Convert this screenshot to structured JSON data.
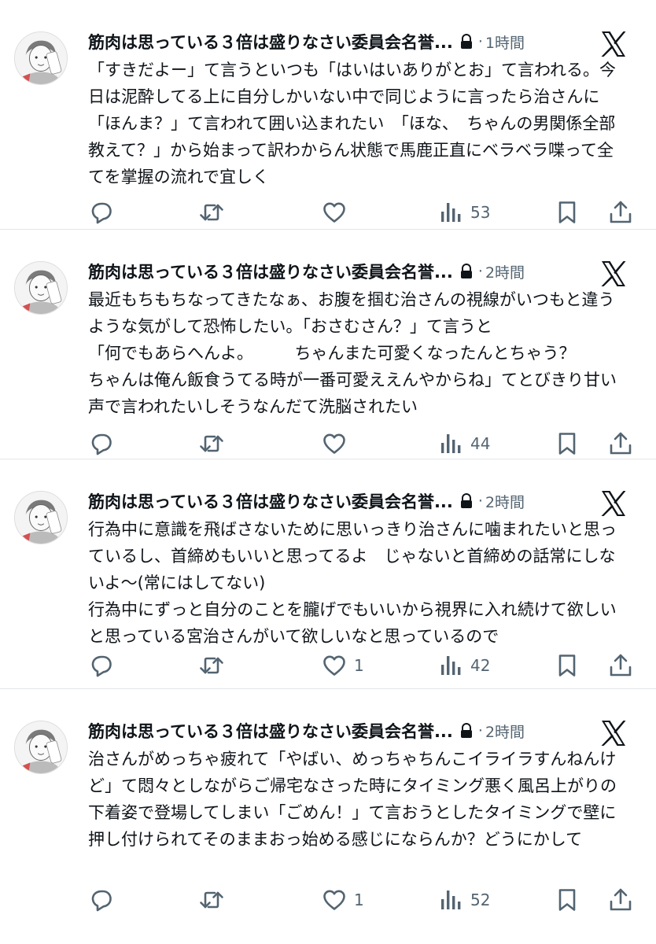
{
  "tweets": [
    {
      "author": "筋肉は思っている３倍は盛りなさい委員会名誉...",
      "time": "1時間",
      "text": "「すきだよー」て言うといつも「はいはいありがとお」て言われる。今日は泥酔してる上に自分しかいない中で同じように言ったら治さんに「ほんま？」て言われて囲い込まれたい　「ほな、　ちゃんの男関係全部教えて？」から始まって訳わからん状態で馬鹿正直にベラベラ喋って全てを掌握の流れで宜しく",
      "likes": "",
      "views": "53"
    },
    {
      "author": "筋肉は思っている３倍は盛りなさい委員会名誉...",
      "time": "2時間",
      "text": "最近もちもちなってきたなぁ、お腹を掴む治さんの視線がいつもと違うような気がして恐怖したい。「おさむさん？」て言うと\n「何でもあらへんよ。　　　ちゃんまた可愛くなったんとちゃう？　　　ちゃんは俺ん飯食うてる時が一番可愛ええんやからね」てとびきり甘い声で言われたいしそうなんだて洗脳されたい",
      "likes": "",
      "views": "44"
    },
    {
      "author": "筋肉は思っている３倍は盛りなさい委員会名誉...",
      "time": "2時間",
      "text": "行為中に意識を飛ばさないために思いっきり治さんに噛まれたいと思っているし、首締めもいいと思ってるよ　じゃないと首締めの話常にしないよ〜(常にはしてない)\n行為中にずっと自分のことを朧げでもいいから視界に入れ続けて欲しいと思っている宮治さんがいて欲しいなと思っているので",
      "likes": "1",
      "views": "42"
    },
    {
      "author": "筋肉は思っている３倍は盛りなさい委員会名誉...",
      "time": "2時間",
      "text": "治さんがめっちゃ疲れて「やばい、めっちゃちんこイライラすんねんけど」て悶々としながらご帰宅なさった時にタイミング悪く風呂上がりの下着姿で登場してしまい「ごめん！」て言おうとしたタイミングで壁に押し付けられてそのままおっ始める感じにならんか？どうにかして",
      "likes": "1",
      "views": "52"
    }
  ],
  "header_separator": "·",
  "icons": {
    "reply": "reply-icon",
    "retweet": "retweet-icon",
    "like": "like-icon",
    "views": "views-icon",
    "bookmark": "bookmark-icon",
    "share": "share-icon",
    "lock": "lock-icon",
    "x_logo": "x-logo-icon"
  },
  "colors": {
    "text": "#0f1419",
    "secondary": "#536471",
    "divider": "#e3e6e9"
  }
}
